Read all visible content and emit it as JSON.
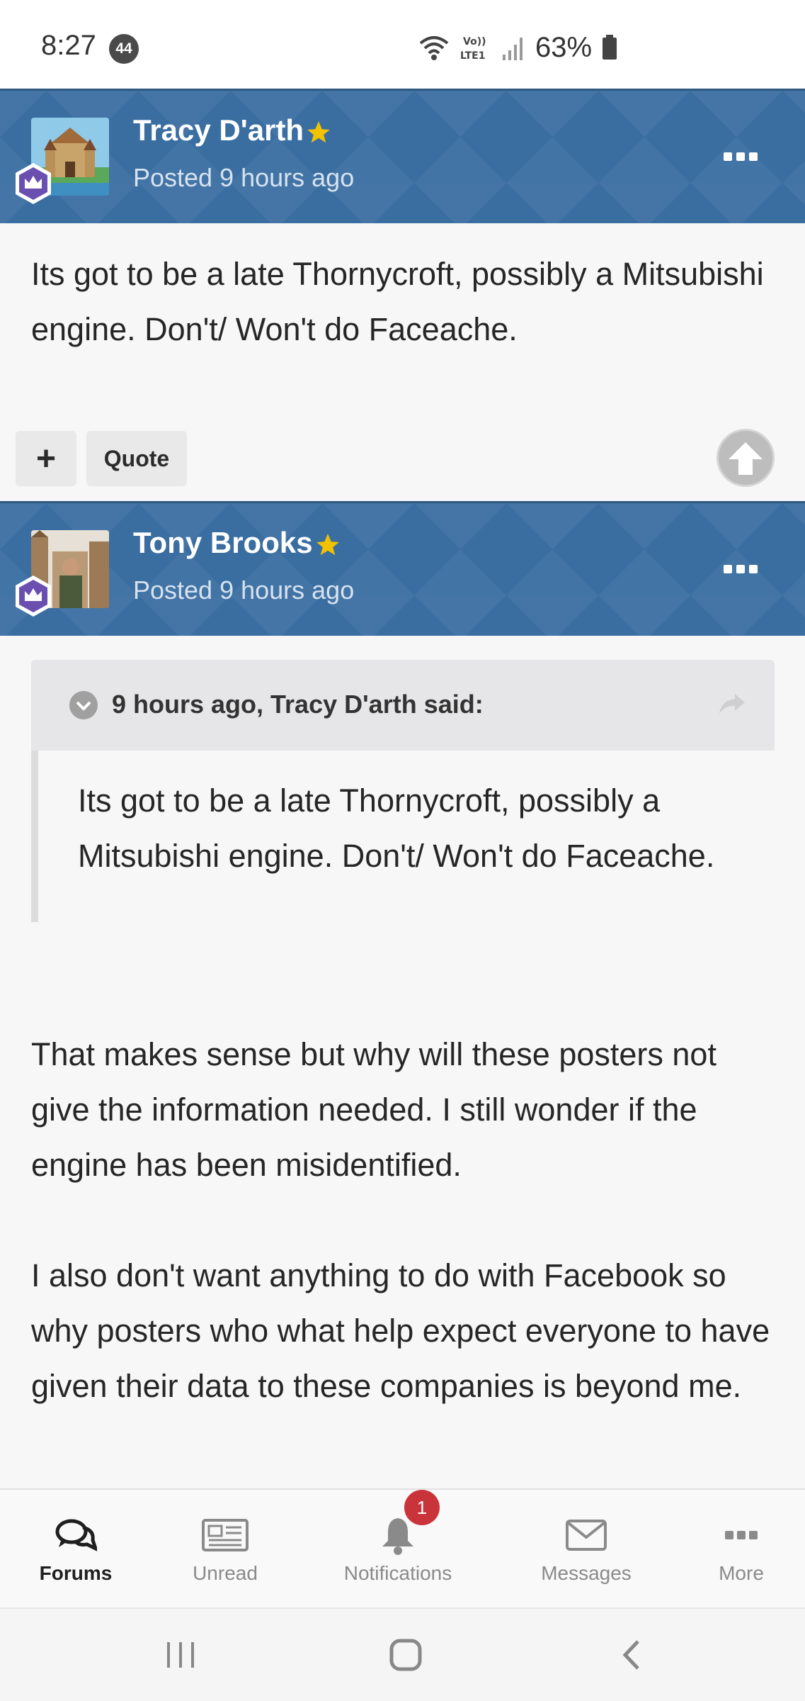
{
  "status_bar": {
    "time": "8:27",
    "notification_count": "44",
    "battery": "63%"
  },
  "posts": [
    {
      "author": "Tracy D'arth",
      "posted": "Posted 9 hours ago",
      "body": "Its got to be a late Thornycroft, possibly a Mitsubishi engine.  Don't/ Won't do Faceache."
    },
    {
      "author": "Tony Brooks",
      "posted": "Posted 9 hours ago",
      "quote": {
        "header": "9 hours ago, Tracy D'arth said:",
        "text": "Its got to be a late Thornycroft, possibly a Mitsubishi engine.  Don't/ Won't do Faceache."
      },
      "body_paragraphs": [
        "That makes sense but why will these posters not give the information needed. I still wonder if the engine has been misidentified.",
        "I also don't want anything to do with Facebook so why posters who what help expect everyone to have given their data to these companies is beyond me."
      ]
    }
  ],
  "actions": {
    "plus_label": "+",
    "quote_label": "Quote"
  },
  "tabbar": {
    "tabs": [
      {
        "label": "Forums",
        "icon": "forums-icon",
        "active": true
      },
      {
        "label": "Unread",
        "icon": "unread-icon",
        "active": false
      },
      {
        "label": "Notifications",
        "icon": "bell-icon",
        "active": false,
        "badge": "1"
      },
      {
        "label": "Messages",
        "icon": "envelope-icon",
        "active": false
      },
      {
        "label": "More",
        "icon": "more-icon",
        "active": false
      }
    ]
  },
  "colors": {
    "header_blue": "#3a6ea1",
    "badge_red": "#c8343a",
    "star_gold": "#f2c200"
  }
}
